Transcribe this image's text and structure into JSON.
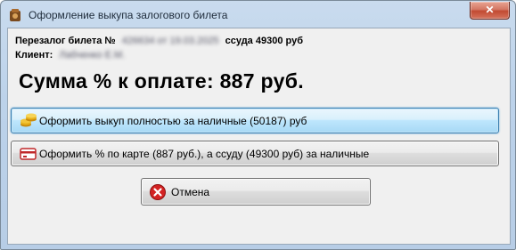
{
  "window": {
    "title": "Оформление выкупа залогового билета",
    "close_glyph": "✕"
  },
  "info": {
    "ticket_label": "Перезалог билета №",
    "ticket_number_blurred": "426634 от 19.03.2025",
    "loan_text": "ссуда 49300 руб",
    "client_label": "Клиент:",
    "client_name_blurred": "Лабченко Е.М."
  },
  "summary": {
    "text": "Сумма % к оплате: 887 руб."
  },
  "buttons": {
    "cash_full": {
      "label": "Оформить выкуп полностью за наличные (50187) руб",
      "icon": "coins-icon"
    },
    "card_percent": {
      "label": "Оформить % по карте (887 руб.), а ссуду (49300 руб) за наличные",
      "icon": "card-icon"
    },
    "cancel": {
      "label": "Отмена",
      "icon": "cancel-icon"
    }
  },
  "colors": {
    "frame": "#bcd2ea",
    "client_bg": "#f0f0f0",
    "close_red": "#c24a32",
    "cancel_red": "#d32222",
    "coin_gold": "#e8b21a"
  }
}
